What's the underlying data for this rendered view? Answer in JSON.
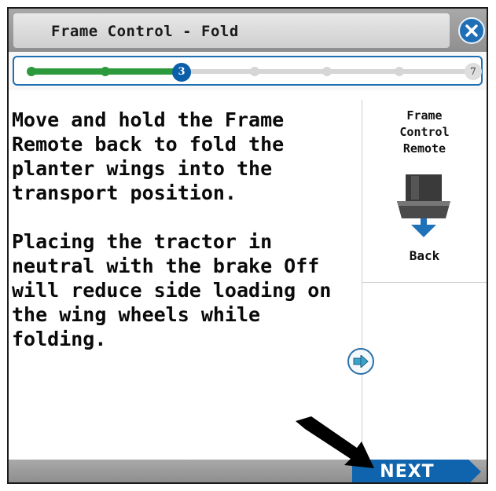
{
  "header": {
    "title": "Frame Control - Fold",
    "close_icon": "close-icon"
  },
  "progress": {
    "current_step": "3",
    "total_steps": "7",
    "completed_color": "#2c9a3c",
    "current_color": "#0b5ea8"
  },
  "instructions": {
    "paragraph_1": "Move and hold the Frame Remote back to fold the planter wings into the transport position.",
    "paragraph_2": "Placing the tractor in neutral with the brake Off will reduce side loading on the wing wheels while folding."
  },
  "side_panel": {
    "label_line1": "Frame",
    "label_line2": "Control",
    "label_line3": "Remote",
    "icon": "remote-lever-icon",
    "direction_label": "Back"
  },
  "expand_icon": "arrow-right-icon",
  "footer": {
    "next_label": "NEXT",
    "accent_color": "#0f64ad"
  }
}
